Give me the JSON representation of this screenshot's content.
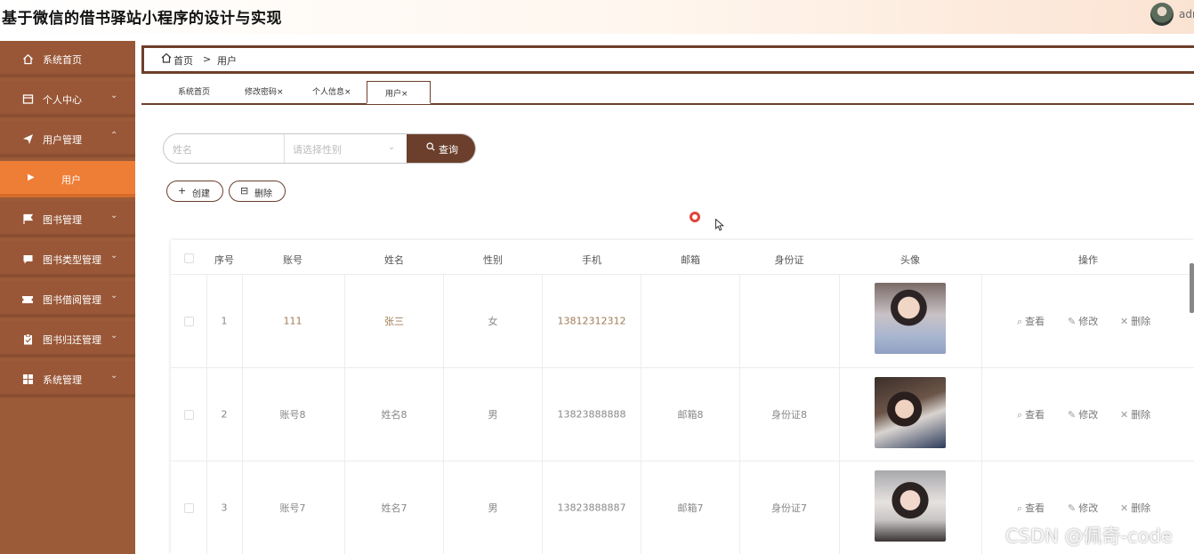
{
  "header": {
    "title": "基于微信的借书驿站小程序的设计与实现",
    "user": "adr"
  },
  "sidebar": {
    "items": [
      {
        "label": "系统首页",
        "icon": "home-icon",
        "has_chevron": false
      },
      {
        "label": "个人中心",
        "icon": "card-icon",
        "has_chevron": true,
        "chevron": "down"
      },
      {
        "label": "用户管理",
        "icon": "paper-plane-icon",
        "has_chevron": true,
        "chevron": "up"
      },
      {
        "label": "用户",
        "icon": "caret-right-icon",
        "sub": true,
        "active": true
      },
      {
        "label": "图书管理",
        "icon": "flag-icon",
        "has_chevron": true,
        "chevron": "down"
      },
      {
        "label": "图书类型管理",
        "icon": "message-icon",
        "has_chevron": true,
        "chevron": "down"
      },
      {
        "label": "图书借阅管理",
        "icon": "ticket-icon",
        "has_chevron": true,
        "chevron": "down"
      },
      {
        "label": "图书归还管理",
        "icon": "clipboard-icon",
        "has_chevron": true,
        "chevron": "down"
      },
      {
        "label": "系统管理",
        "icon": "grid-icon",
        "has_chevron": true,
        "chevron": "down"
      }
    ]
  },
  "breadcrumb": {
    "home": "首页",
    "separator": ">",
    "current": "用户"
  },
  "tabs": [
    {
      "label": "系统首页"
    },
    {
      "label": "修改密码×"
    },
    {
      "label": "个人信息×"
    },
    {
      "label": "用户×",
      "active": true
    }
  ],
  "search": {
    "name_placeholder": "姓名",
    "sex_placeholder": "请选择性别",
    "button_label": "查询"
  },
  "actions": {
    "create": "创建",
    "delete": "删除"
  },
  "table": {
    "headers": [
      "序号",
      "账号",
      "姓名",
      "性别",
      "手机",
      "邮箱",
      "身份证",
      "头像",
      "操作"
    ],
    "rows": [
      {
        "index": "1",
        "account": "111",
        "name": "张三",
        "sex": "女",
        "phone": "13812312312",
        "email": "",
        "id_card": ""
      },
      {
        "index": "2",
        "account": "账号8",
        "name": "姓名8",
        "sex": "男",
        "phone": "13823888888",
        "email": "邮箱8",
        "id_card": "身份证8"
      },
      {
        "index": "3",
        "account": "账号7",
        "name": "姓名7",
        "sex": "男",
        "phone": "13823888887",
        "email": "邮箱7",
        "id_card": "身份证7"
      }
    ],
    "row_actions": {
      "view": "查看",
      "edit": "修改",
      "delete": "删除"
    }
  },
  "watermark": "CSDN @佩奇-code",
  "colors": {
    "sidebar": "#9b5a38",
    "active": "#ee7d36",
    "accent": "#6b3f2c"
  }
}
